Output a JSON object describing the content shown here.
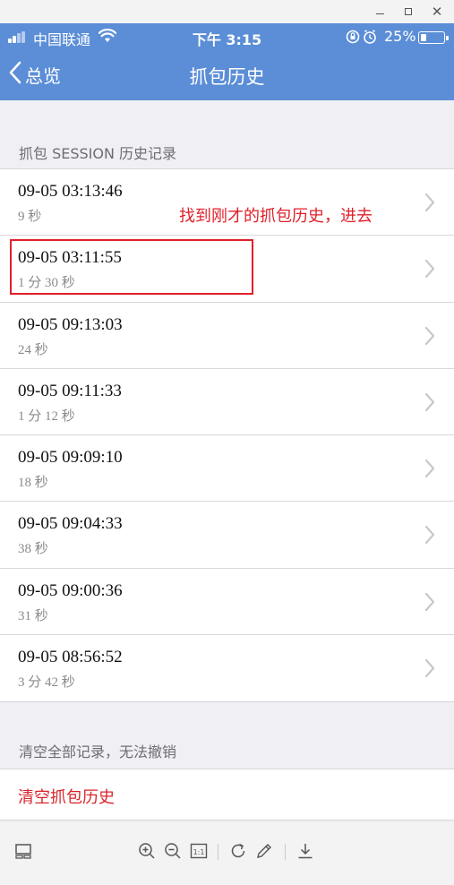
{
  "status_bar": {
    "carrier": "中国联通",
    "time": "下午 3:15",
    "battery": "25%",
    "battery_level": 0.25
  },
  "nav": {
    "back_label": "总览",
    "title": "抓包历史"
  },
  "section_header": "抓包 SESSION 历史记录",
  "sessions": [
    {
      "time": "09-05 03:13:46",
      "duration": "9 秒"
    },
    {
      "time": "09-05 03:11:55",
      "duration": "1 分 30 秒"
    },
    {
      "time": "09-05 09:13:03",
      "duration": "24 秒"
    },
    {
      "time": "09-05 09:11:33",
      "duration": "1 分 12 秒"
    },
    {
      "time": "09-05 09:09:10",
      "duration": "18 秒"
    },
    {
      "time": "09-05 09:04:33",
      "duration": "38 秒"
    },
    {
      "time": "09-05 09:00:36",
      "duration": "31 秒"
    },
    {
      "time": "09-05 08:56:52",
      "duration": "3 分 42 秒"
    }
  ],
  "annotation": "找到刚才的抓包历史，进去",
  "clear": {
    "hint": "清空全部记录，无法撤销",
    "button_label": "清空抓包历史"
  },
  "colors": {
    "nav_blue": "#5b8ed6",
    "annotation_red": "#e0202a",
    "destructive_red": "#d9252b"
  },
  "toolbar_icons": [
    "layout-icon",
    "zoom-in-icon",
    "zoom-out-icon",
    "actual-size-icon",
    "rotate-icon",
    "edit-icon",
    "download-icon"
  ],
  "toolbar_actual_size_label": "1:1"
}
